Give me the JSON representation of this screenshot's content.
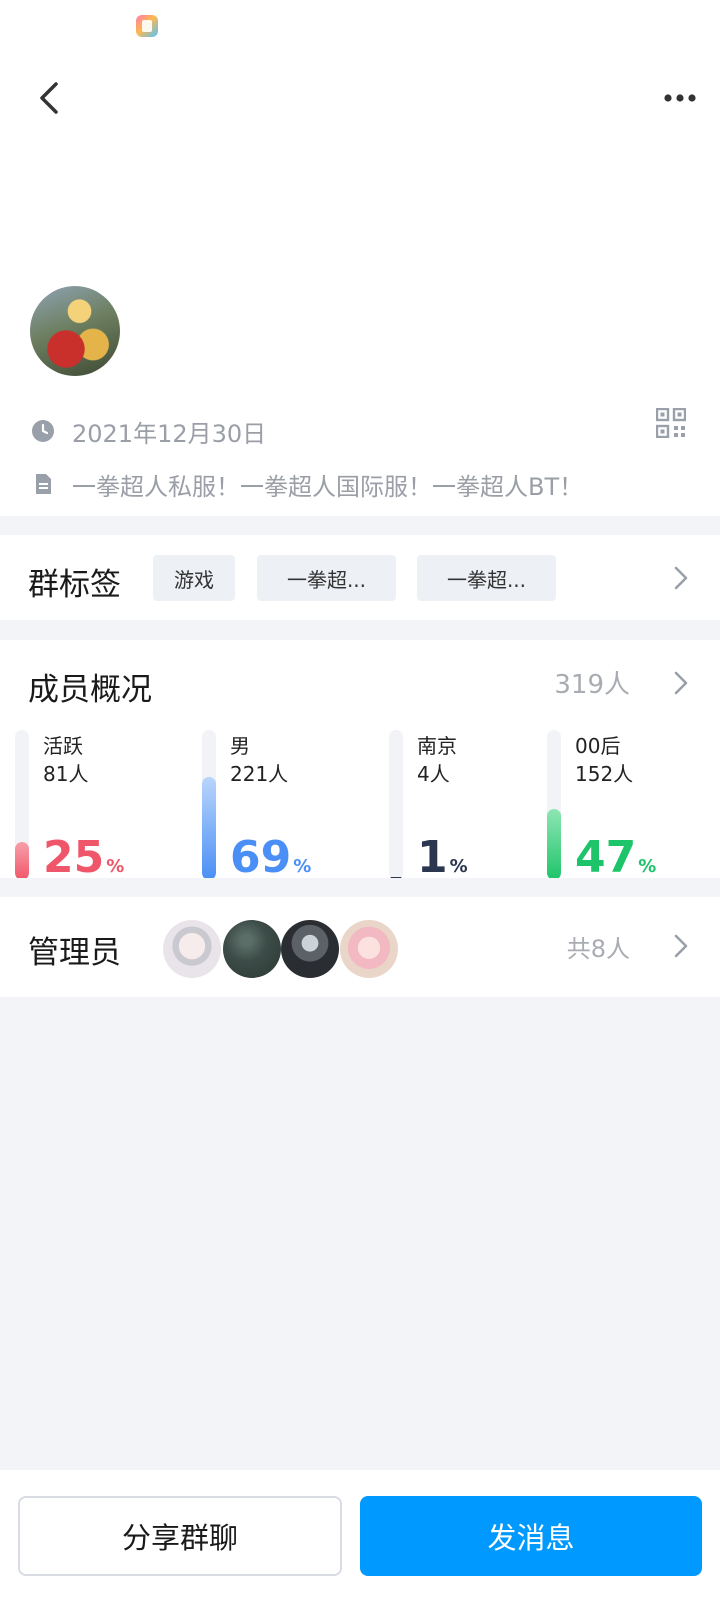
{
  "icons": {
    "back": "back-arrow-icon",
    "more": "more-dots-icon",
    "clock": "clock-icon",
    "description": "document-icon",
    "qr": "qr-code-icon",
    "chevron": "chevron-right-icon"
  },
  "group": {
    "created_date": "2021年12月30日",
    "description": "一拳超人私服！一拳超人国际服！一拳超人BT！"
  },
  "tags": {
    "title": "群标签",
    "items": [
      "游戏",
      "一拳超...",
      "一拳超..."
    ]
  },
  "members": {
    "title": "成员概况",
    "total": "319人",
    "stats": [
      {
        "label": "活跃",
        "count": "81人",
        "percent": "25",
        "fill": 0.25,
        "color": "#f0566a",
        "fill_top": "#f7a0aa"
      },
      {
        "label": "男",
        "count": "221人",
        "percent": "69",
        "fill": 0.69,
        "color": "#4a8ff5",
        "fill_top": "#b9d5fb"
      },
      {
        "label": "南京",
        "count": "4人",
        "percent": "1",
        "fill": 0.01,
        "color": "#2a3550",
        "fill_top": "#2a3550"
      },
      {
        "label": "00后",
        "count": "152人",
        "percent": "47",
        "fill": 0.47,
        "color": "#1ec46a",
        "fill_top": "#8ee6b3"
      }
    ],
    "percent_unit": "%"
  },
  "admins": {
    "title": "管理员",
    "total": "共8人"
  },
  "actions": {
    "share_label": "分享群聊",
    "send_label": "发消息",
    "send_color": "#0099ff"
  }
}
